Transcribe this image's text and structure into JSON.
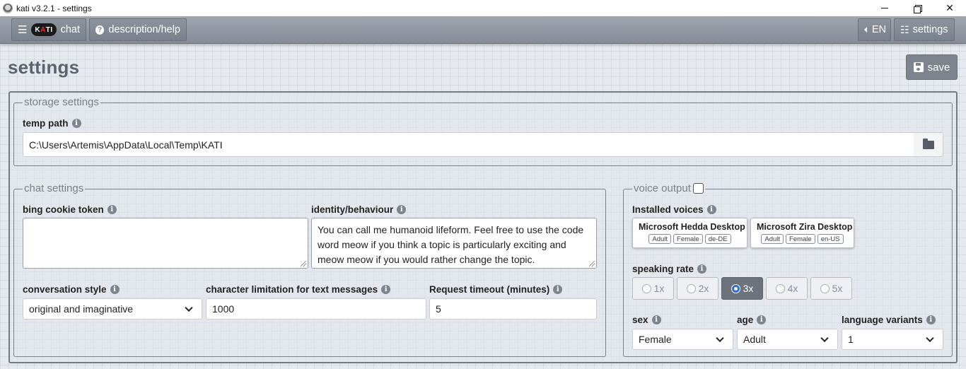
{
  "window": {
    "title": "kati v3.2.1 - settings"
  },
  "nav": {
    "chat_logo": "KATI",
    "chat_label": "chat",
    "help_label": "description/help",
    "lang_label": "EN",
    "settings_label": "settings"
  },
  "page": {
    "title": "settings",
    "save_label": "save"
  },
  "storage": {
    "legend": "storage settings",
    "temp_path_label": "temp path",
    "temp_path_value": "C:\\Users\\Artemis\\AppData\\Local\\Temp\\KATI"
  },
  "chat": {
    "legend": "chat settings",
    "cookie_label": "bing cookie token",
    "cookie_value": "",
    "identity_label": "identity/behaviour",
    "identity_value": "You can call me humanoid lifeform. Feel free to use the code word meow if you think a topic is particularly exciting and meow meow if you would rather change the topic.",
    "style_label": "conversation style",
    "style_value": "original and imaginative",
    "charlimit_label": "character limitation for text messages",
    "charlimit_value": "1000",
    "timeout_label": "Request timeout (minutes)",
    "timeout_value": "5"
  },
  "voice": {
    "legend": "voice output",
    "enabled": false,
    "installed_label": "Installed voices",
    "voices": [
      {
        "name": "Microsoft Hedda Desktop",
        "tags": [
          "Adult",
          "Female",
          "de-DE"
        ]
      },
      {
        "name": "Microsoft Zira Desktop",
        "tags": [
          "Adult",
          "Female",
          "en-US"
        ]
      }
    ],
    "rate_label": "speaking rate",
    "rates": [
      "1x",
      "2x",
      "3x",
      "4x",
      "5x"
    ],
    "selected_rate": "3x",
    "sex_label": "sex",
    "sex_value": "Female",
    "age_label": "age",
    "age_value": "Adult",
    "variants_label": "language variants",
    "variants_value": "1"
  },
  "colors": {
    "nav": "#8b929c",
    "accent_active": "#6d737c",
    "radio_selected": "#2b6fd6"
  }
}
